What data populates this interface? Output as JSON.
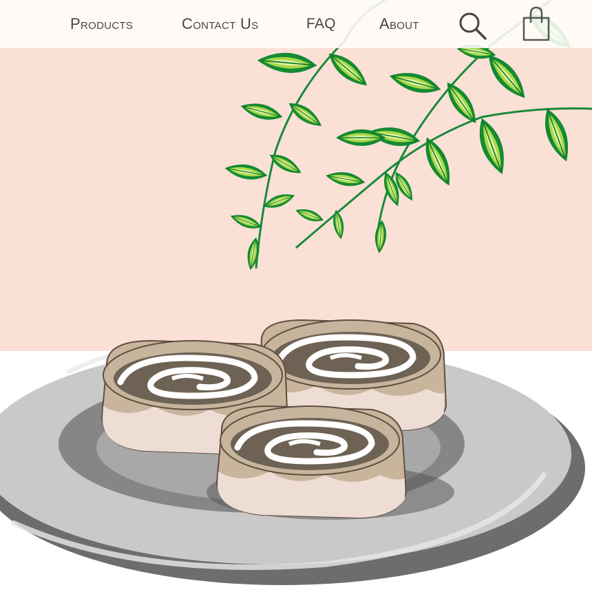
{
  "nav": {
    "items": [
      {
        "label": "Products"
      },
      {
        "label": "Contact Us"
      },
      {
        "label": "FAQ"
      },
      {
        "label": "About"
      }
    ],
    "search_icon": "search-icon",
    "cart_icon": "shopping-bag-icon"
  },
  "hero": {
    "illustration": "cinnamon-rolls-on-plate",
    "decoration": "green-leafy-branch"
  },
  "colors": {
    "header_bg": "#fffdfb",
    "hero_bg": "#fbe0d6",
    "nav_text": "#454545",
    "leaf_green": "#1e9a3c",
    "plate_gray": "#c8c8c8"
  }
}
